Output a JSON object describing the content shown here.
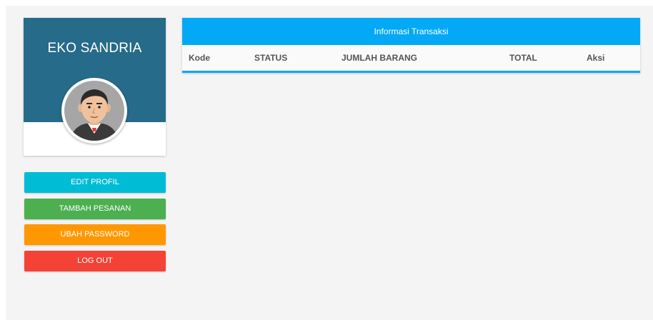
{
  "profile": {
    "name": "EKO SANDRIA"
  },
  "actions": {
    "edit_profile": "EDIT PROFIL",
    "add_order": "TAMBAH PESANAN",
    "change_password": "UBAH PASSWORD",
    "logout": "LOG OUT"
  },
  "transactions": {
    "title": "Informasi Transaksi",
    "columns": [
      "Kode",
      "STATUS",
      "JUMLAH BARANG",
      "TOTAL",
      "Aksi"
    ],
    "rows": []
  },
  "colors": {
    "profile_banner": "#266b89",
    "edit_button": "#00bcd4",
    "add_button": "#4caf50",
    "password_button": "#ff9800",
    "logout_button": "#f44336",
    "table_header": "#03a9f4"
  }
}
